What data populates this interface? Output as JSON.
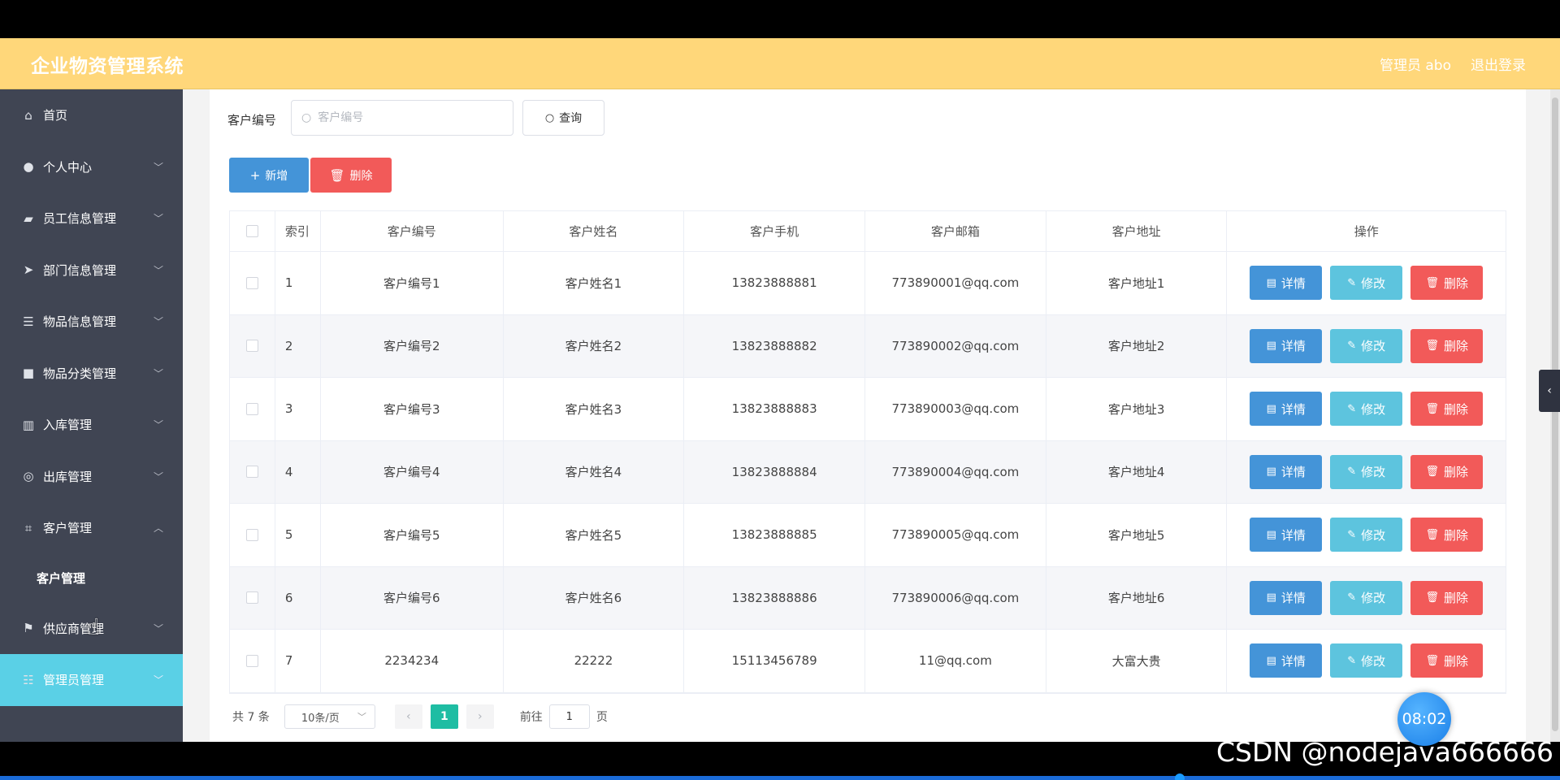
{
  "header": {
    "title": "企业物资管理系统",
    "user": "管理员 abo",
    "logout": "退出登录",
    "bg_color": "#ffd77a"
  },
  "sidebar": {
    "items": [
      {
        "label": "首页",
        "icon": "home-icon"
      },
      {
        "label": "个人中心",
        "icon": "user-icon"
      },
      {
        "label": "员工信息管理",
        "icon": "briefcase-icon"
      },
      {
        "label": "部门信息管理",
        "icon": "send-icon"
      },
      {
        "label": "物品信息管理",
        "icon": "list-icon"
      },
      {
        "label": "物品分类管理",
        "icon": "folder-icon"
      },
      {
        "label": "入库管理",
        "icon": "chart-icon"
      },
      {
        "label": "出库管理",
        "icon": "compass-icon"
      },
      {
        "label": "客户管理",
        "icon": "crop-icon"
      },
      {
        "label": "供应商管理",
        "icon": "flag-icon"
      },
      {
        "label": "管理员管理",
        "icon": "sliders-icon"
      }
    ],
    "submenu_label": "客户管理",
    "active_color": "#5ad0e6"
  },
  "search": {
    "label": "客户编号",
    "placeholder": "客户编号",
    "query_label": "查询"
  },
  "toolbar": {
    "add_label": "新增",
    "delete_label": "删除"
  },
  "table": {
    "headers": [
      "索引",
      "客户编号",
      "客户姓名",
      "客户手机",
      "客户邮箱",
      "客户地址",
      "操作"
    ],
    "rows": [
      {
        "idx": "1",
        "no": "客户编号1",
        "name": "客户姓名1",
        "phone": "13823888881",
        "email": "773890001@qq.com",
        "addr": "客户地址1"
      },
      {
        "idx": "2",
        "no": "客户编号2",
        "name": "客户姓名2",
        "phone": "13823888882",
        "email": "773890002@qq.com",
        "addr": "客户地址2"
      },
      {
        "idx": "3",
        "no": "客户编号3",
        "name": "客户姓名3",
        "phone": "13823888883",
        "email": "773890003@qq.com",
        "addr": "客户地址3"
      },
      {
        "idx": "4",
        "no": "客户编号4",
        "name": "客户姓名4",
        "phone": "13823888884",
        "email": "773890004@qq.com",
        "addr": "客户地址4"
      },
      {
        "idx": "5",
        "no": "客户编号5",
        "name": "客户姓名5",
        "phone": "13823888885",
        "email": "773890005@qq.com",
        "addr": "客户地址5"
      },
      {
        "idx": "6",
        "no": "客户编号6",
        "name": "客户姓名6",
        "phone": "13823888886",
        "email": "773890006@qq.com",
        "addr": "客户地址6"
      },
      {
        "idx": "7",
        "no": "2234234",
        "name": "22222",
        "phone": "15113456789",
        "email": "11@qq.com",
        "addr": "大富大贵"
      }
    ],
    "actions": {
      "detail": "详情",
      "edit": "修改",
      "delete": "删除"
    },
    "colors": {
      "detail": "#4494d8",
      "edit": "#5dc4de",
      "delete": "#f25a59"
    }
  },
  "pagination": {
    "total": "共 7 条",
    "page_size": "10条/页",
    "current_page": "1",
    "goto_label": "前往",
    "goto_value": "1",
    "page_suffix": "页",
    "active_color": "#1ebda3"
  },
  "overlay": {
    "timer": "08:02",
    "watermark": "CSDN @nodejava666666"
  }
}
